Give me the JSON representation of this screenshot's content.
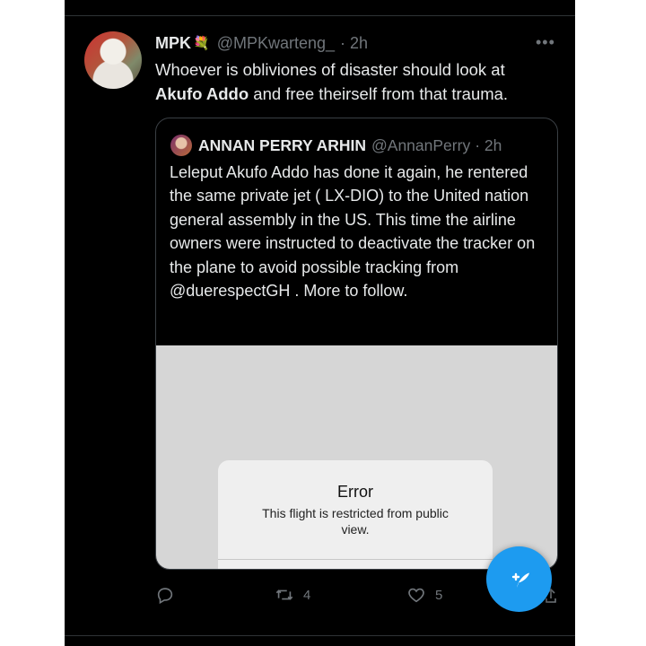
{
  "tweet": {
    "author_name": "MPK",
    "author_emoji": "💐",
    "author_handle": "@MPKwarteng_",
    "time": "· 2h",
    "more_icon": "more-horizontal-icon",
    "text_before": "Whoever is obliviones of disaster should look at",
    "text_bold": "Akufo Addo",
    "text_after": " and free theirself from that trauma."
  },
  "quote": {
    "author_name": "ANNAN PERRY ARHIN",
    "author_handle": "@AnnanPerry",
    "time": "· 2h",
    "text": "Leleput Akufo Addo has done it again, he rentered the same private jet ( LX-DIO) to the United nation general assembly in the US. This time the airline owners were instructed to deactivate the tracker on the plane to avoid possible tracking from @duerespectGH . More to follow.",
    "media": {
      "error_title": "Error",
      "error_message": "This flight is restricted from public view."
    }
  },
  "actions": {
    "reply_icon": "reply-icon",
    "retweet_icon": "retweet-icon",
    "retweet_count": "4",
    "like_icon": "heart-icon",
    "like_count": "5",
    "share_icon": "share-icon"
  },
  "compose_button": {
    "icon": "compose-tweet-icon"
  },
  "colors": {
    "background": "#000000",
    "text": "#e7e9ea",
    "secondary": "#71767b",
    "accent": "#1d9bf0"
  }
}
